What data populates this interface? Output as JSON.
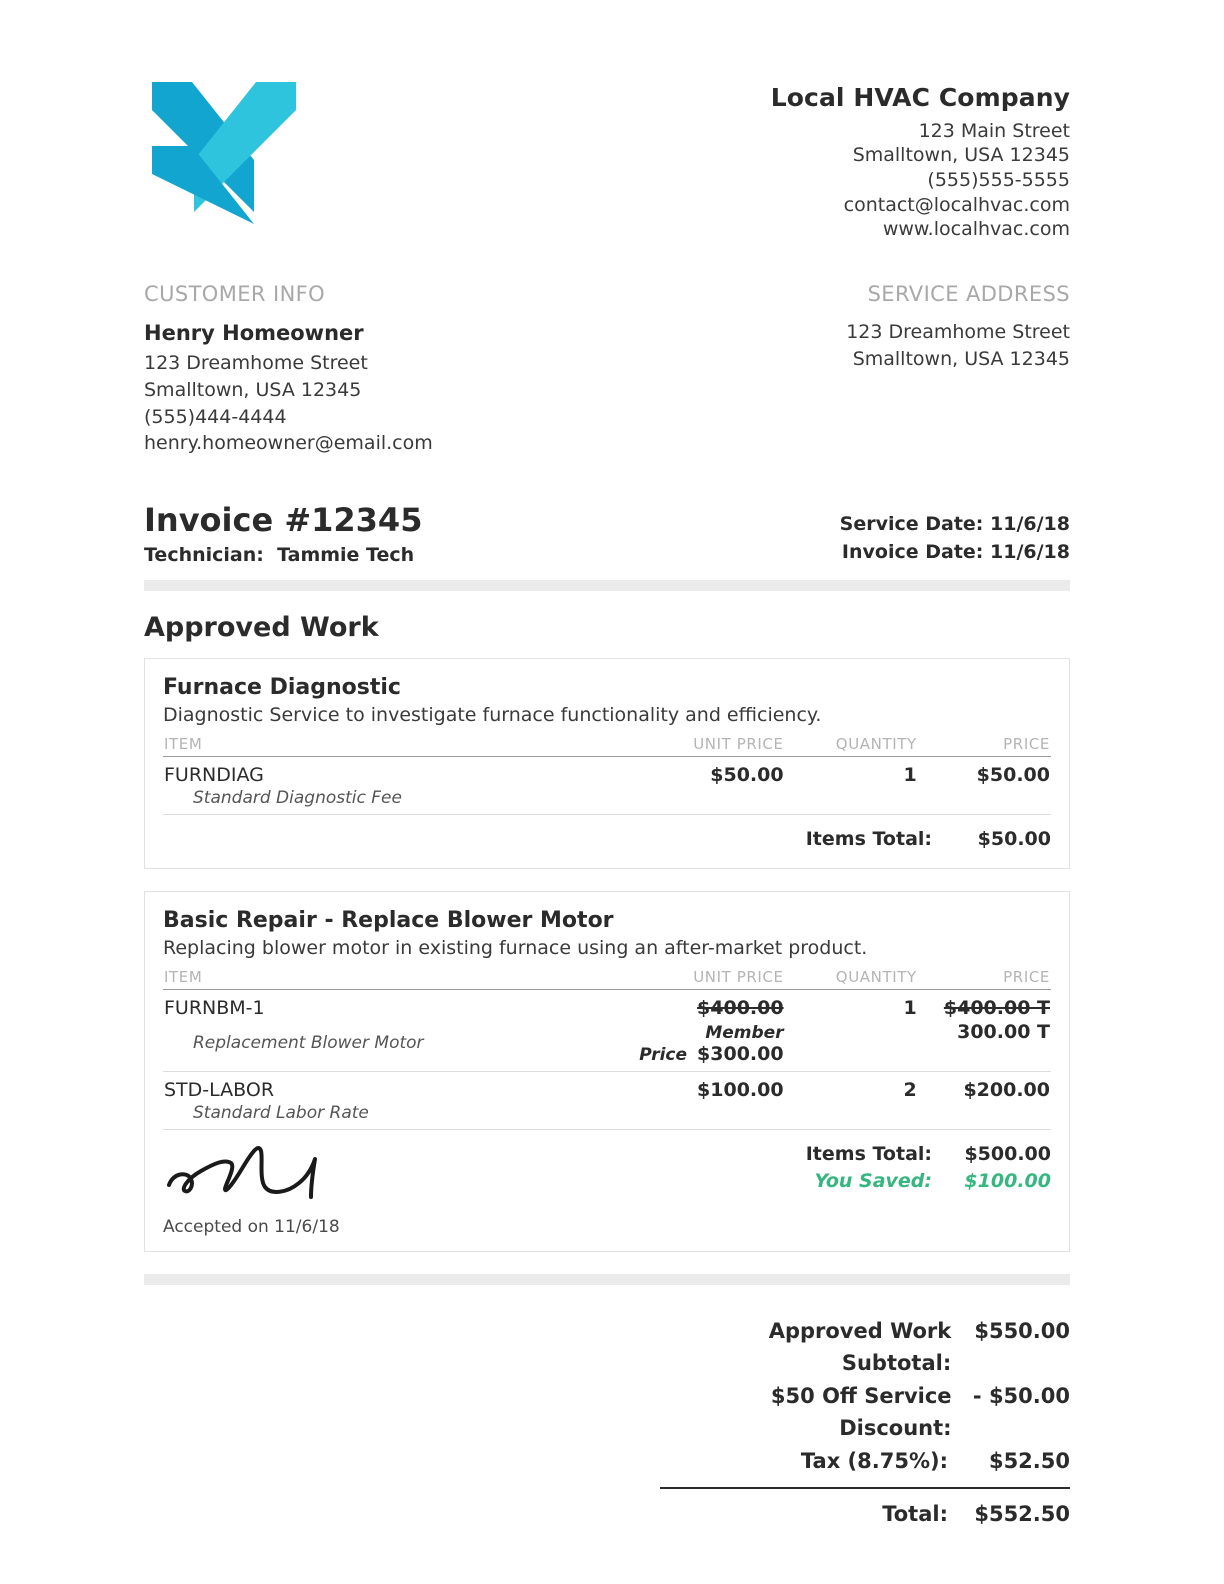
{
  "company": {
    "logo_icon": "chevron-logo-icon",
    "logo_color_dark": "#12a5cf",
    "logo_color_light": "#2ec4de",
    "name": "Local HVAC Company",
    "address_line1": "123 Main Street",
    "address_line2": "Smalltown, USA 12345",
    "phone": "(555)555-5555",
    "email": "contact@localhvac.com",
    "website": "www.localhvac.com"
  },
  "customer": {
    "heading": "CUSTOMER INFO",
    "name": "Henry Homeowner",
    "address_line1": "123 Dreamhome Street",
    "address_line2": "Smalltown, USA 12345",
    "phone": "(555)444-4444",
    "email": "henry.homeowner@email.com"
  },
  "service_address": {
    "heading": "SERVICE ADDRESS",
    "line1": "123 Dreamhome Street",
    "line2": "Smalltown, USA 12345"
  },
  "invoice": {
    "number_label": "Invoice #12345",
    "technician_label": "Technician:",
    "technician_name": "Tammie Tech",
    "service_date": "Service Date: 11/6/18",
    "invoice_date": "Invoice Date: 11/6/18"
  },
  "approved_work": {
    "section_title": "Approved Work",
    "columns": {
      "item": "ITEM",
      "unit_price": "UNIT PRICE",
      "quantity": "QUANTITY",
      "price": "PRICE"
    },
    "cards": [
      {
        "title": "Furnace  Diagnostic",
        "description": "Diagnostic Service to investigate furnace functionality and efficiency.",
        "lines": [
          {
            "sku": "FURNDIAG",
            "description": "Standard Diagnostic Fee",
            "unit_price": "$50.00",
            "quantity": "1",
            "price": "$50.00"
          }
        ],
        "items_total_label": "Items Total:",
        "items_total_value": "$50.00"
      },
      {
        "title": "Basic Repair - Replace Blower Motor",
        "description": "Replacing blower motor in existing furnace using an after-market product.",
        "lines": [
          {
            "sku": "FURNBM-1",
            "description": "Replacement Blower Motor",
            "unit_price_original": "$400.00",
            "member_price_label": "Member Price",
            "unit_price": "$300.00",
            "quantity": "1",
            "price_original": "$400.00 T",
            "price": "300.00 T"
          },
          {
            "sku": "STD-LABOR",
            "description": "Standard Labor Rate",
            "unit_price": "$100.00",
            "quantity": "2",
            "price": "$200.00"
          }
        ],
        "items_total_label": "Items Total:",
        "items_total_value": "$500.00",
        "you_saved_label": "You Saved:",
        "you_saved_value": "$100.00",
        "you_saved_color": "#35b77f",
        "signature_icon": "handwritten-signature-icon",
        "accepted_text": "Accepted on 11/6/18"
      }
    ]
  },
  "totals": {
    "subtotal_label": "Approved Work Subtotal:",
    "subtotal_value": "$550.00",
    "discount_label": "$50 Off Service Discount:",
    "discount_value": "- $50.00",
    "tax_label": "Tax (8.75%):",
    "tax_value": "$52.50",
    "total_label": "Total:",
    "total_value": "$552.50"
  }
}
